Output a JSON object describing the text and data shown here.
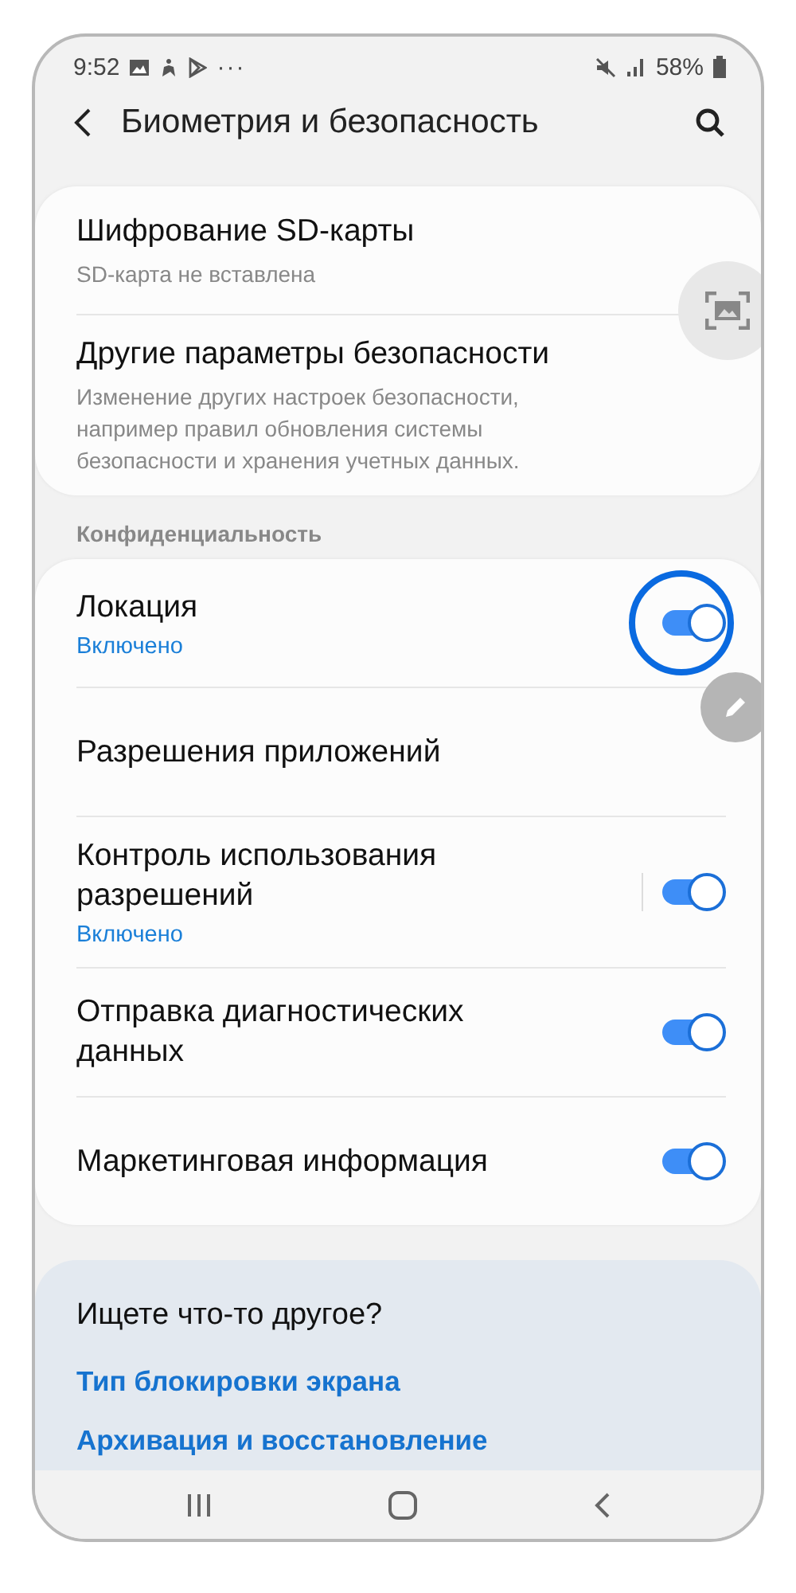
{
  "status_bar": {
    "time": "9:52",
    "more": "···",
    "battery": "58%"
  },
  "header": {
    "title": "Биометрия и безопасность"
  },
  "groups": [
    {
      "items": [
        {
          "kind": "nav",
          "title": "Шифрование SD-карты",
          "subtitle": "SD-карта не вставлена"
        },
        {
          "kind": "nav",
          "title": "Другие параметры безопасности",
          "subtitle": "Изменение других настроек безопасности, например правил обновления системы безопасности и хранения учетных данных."
        }
      ]
    },
    {
      "label": "Конфиденциальность",
      "items": [
        {
          "kind": "toggle",
          "title": "Локация",
          "status": "Включено",
          "on": true,
          "highlighted": true,
          "divider": false
        },
        {
          "kind": "nav",
          "title": "Разрешения приложений"
        },
        {
          "kind": "toggle",
          "title": "Контроль использования разрешений",
          "status": "Включено",
          "on": true,
          "highlighted": false,
          "divider": true
        },
        {
          "kind": "toggle",
          "title": "Отправка диагностических данных",
          "on": true,
          "highlighted": false,
          "divider": false
        },
        {
          "kind": "toggle",
          "title": "Маркетинговая информация",
          "on": true,
          "highlighted": false,
          "divider": false
        }
      ]
    }
  ],
  "suggestions": {
    "title": "Ищете что-то другое?",
    "links": [
      "Тип блокировки экрана",
      "Архивация и восстановление"
    ]
  }
}
